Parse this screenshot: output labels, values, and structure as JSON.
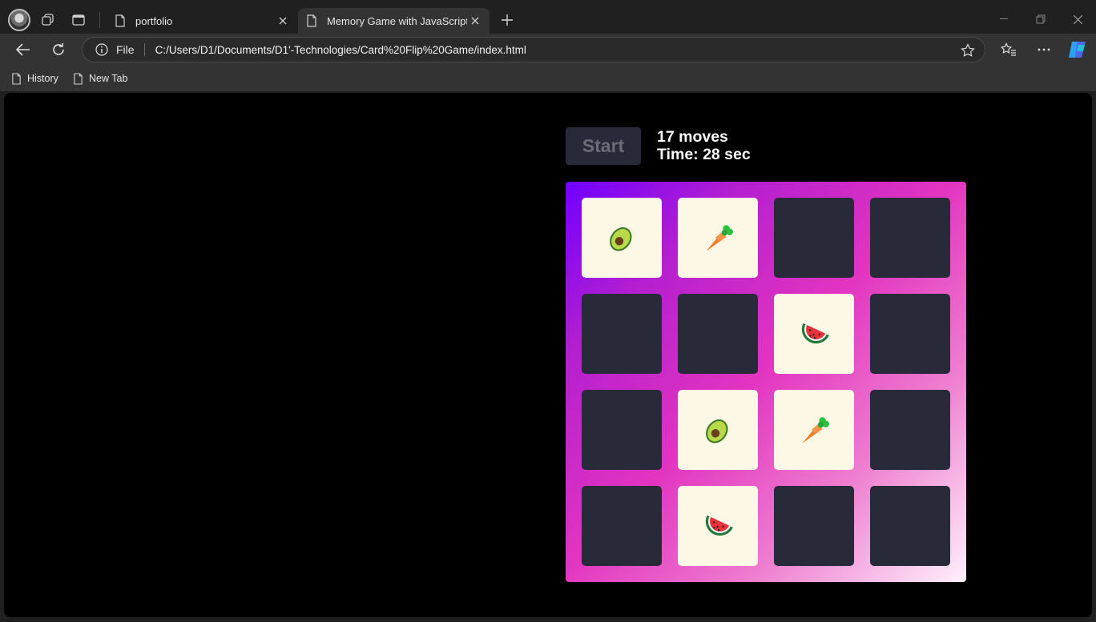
{
  "browser": {
    "tabs": [
      {
        "title": "portfolio",
        "active": false
      },
      {
        "title": "Memory Game with JavaScript",
        "active": true
      }
    ],
    "address": {
      "scheme_label": "File",
      "url": "C:/Users/D1/Documents/D1'-Technologies/Card%20Flip%20Game/index.html"
    },
    "bookmarks": [
      {
        "label": "History"
      },
      {
        "label": "New Tab"
      }
    ]
  },
  "game": {
    "start_label": "Start",
    "moves_text": "17 moves",
    "time_text": "Time: 28 sec",
    "cards": [
      {
        "flipped": true,
        "emoji": "avocado-icon"
      },
      {
        "flipped": true,
        "emoji": "carrot-icon"
      },
      {
        "flipped": false,
        "emoji": ""
      },
      {
        "flipped": false,
        "emoji": ""
      },
      {
        "flipped": false,
        "emoji": ""
      },
      {
        "flipped": false,
        "emoji": ""
      },
      {
        "flipped": true,
        "emoji": "watermelon-icon"
      },
      {
        "flipped": false,
        "emoji": ""
      },
      {
        "flipped": false,
        "emoji": ""
      },
      {
        "flipped": true,
        "emoji": "avocado-icon"
      },
      {
        "flipped": true,
        "emoji": "carrot-icon"
      },
      {
        "flipped": false,
        "emoji": ""
      },
      {
        "flipped": false,
        "emoji": ""
      },
      {
        "flipped": true,
        "emoji": "watermelon-icon"
      },
      {
        "flipped": false,
        "emoji": ""
      },
      {
        "flipped": false,
        "emoji": ""
      }
    ]
  },
  "colors": {
    "card_back": "#282a3a",
    "card_face": "#fdf8e6",
    "board_gradient_start": "#6f00ff",
    "board_gradient_end": "#fff0fb"
  }
}
